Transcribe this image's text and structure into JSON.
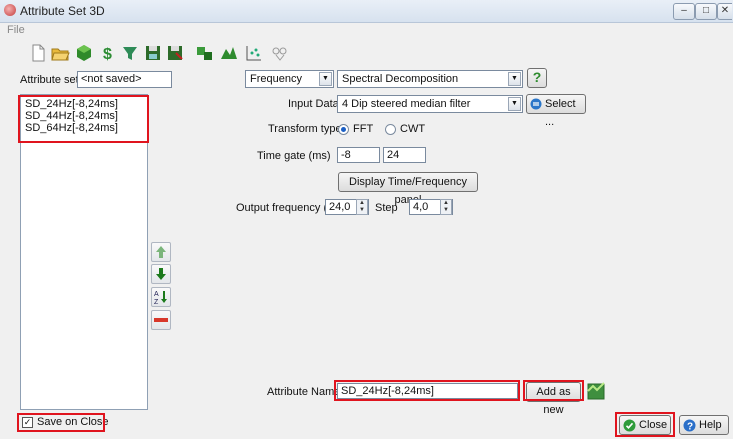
{
  "window": {
    "title": "Attribute Set 3D",
    "controls": [
      "minimize-icon",
      "maximize-icon",
      "close-icon"
    ]
  },
  "menu": {
    "file": "File"
  },
  "toolbar": {
    "icons": [
      "new-icon",
      "open-icon",
      "cube-icon",
      "dollar-icon",
      "filter-icon",
      "save-icon",
      "save-as-icon",
      "attribute-icon",
      "evaluate-icon",
      "cross-plot-icon",
      "scatter-icon"
    ]
  },
  "attribute_set": {
    "label": "Attribute set",
    "value": "<not saved>"
  },
  "attribute_list": {
    "items": [
      "SD_24Hz[-8,24ms]",
      "SD_44Hz[-8,24ms]",
      "SD_64Hz[-8,24ms]"
    ]
  },
  "type_selector": {
    "category": "Frequency",
    "method": "Spectral Decomposition",
    "help_label": "?"
  },
  "input_data": {
    "label": "Input Data",
    "value": "4 Dip steered median filter",
    "select_label": "Select ..."
  },
  "transform_type": {
    "label": "Transform type",
    "options": [
      "FFT",
      "CWT"
    ],
    "selected": "FFT"
  },
  "time_gate": {
    "label": "Time gate (ms)",
    "start": "-8",
    "stop": "24"
  },
  "display_panel_button": "Display Time/Frequency panel",
  "output_frequency": {
    "label": "Output frequency (Hz",
    "value": "24,0",
    "step_label": "Step",
    "step": "4,0"
  },
  "attribute_name": {
    "label": "Attribute Name",
    "value": "SD_24Hz[-8,24ms]",
    "add_label": "Add as new"
  },
  "save_on_close": {
    "label": "Save on Close",
    "checked": true
  },
  "footer": {
    "close_label": "Close",
    "help_label": "Help"
  }
}
